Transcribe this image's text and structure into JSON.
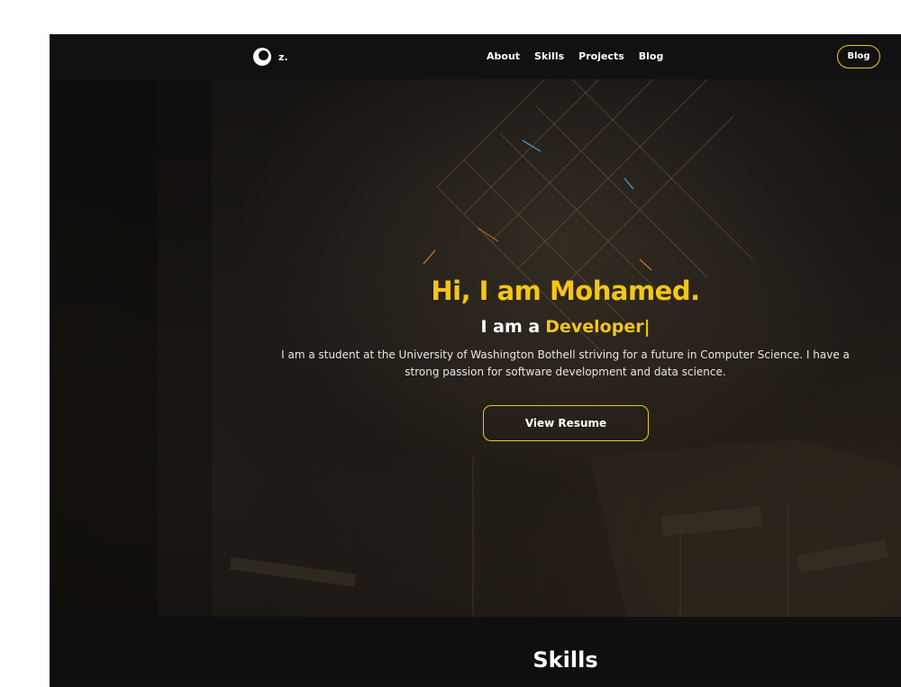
{
  "navbar": {
    "logo_text": "z.",
    "links": [
      "About",
      "Skills",
      "Projects",
      "Blog"
    ],
    "cta_label": "Blog"
  },
  "hero": {
    "title": "Hi, I am Mohamed.",
    "subtitle_prefix": "I am a",
    "subtitle_role": "Developer|",
    "description": "I am a student at the University of Washington Bothell striving for a future in Computer Science. I have a strong passion for software development and data science.",
    "button_label": "View Resume"
  },
  "skills": {
    "title": "Skills"
  },
  "colors": {
    "accent": "#f5c518",
    "background": "#0f0f0f",
    "text": "#ffffff"
  },
  "icons": {
    "logo": "circle-logo-icon"
  }
}
